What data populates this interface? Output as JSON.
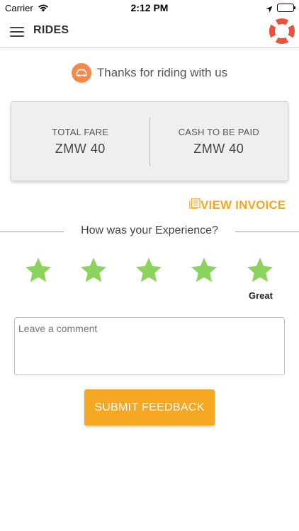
{
  "status_bar": {
    "carrier": "Carrier",
    "time": "2:12 PM",
    "wifi_icon": "wifi-icon",
    "location_icon": "location-arrow-icon",
    "battery_icon": "battery-icon",
    "battery_level": 1.0
  },
  "nav": {
    "title": "RIDES",
    "menu_icon": "hamburger-menu-icon",
    "help_icon": "lifebuoy-icon"
  },
  "thanks": {
    "icon": "car-icon",
    "text": "Thanks for riding with us"
  },
  "fare": {
    "total_label": "TOTAL FARE",
    "total_value": "ZMW 40",
    "cash_label": "CASH TO BE PAID",
    "cash_value": "ZMW 40"
  },
  "invoice": {
    "icon": "invoice-icon",
    "label": "VIEW INVOICE"
  },
  "experience": {
    "question": "How was your Experience?",
    "stars_total": 5,
    "stars_selected": 5,
    "rating_label": "Great"
  },
  "comment": {
    "placeholder": "Leave a comment",
    "value": ""
  },
  "submit": {
    "label": "SUBMIT FEEDBACK"
  },
  "colors": {
    "accent": "#f5a623",
    "car_badge": "#f5894a",
    "star_fill": "#8bd35c",
    "lifebuoy_red": "#e8533f"
  }
}
